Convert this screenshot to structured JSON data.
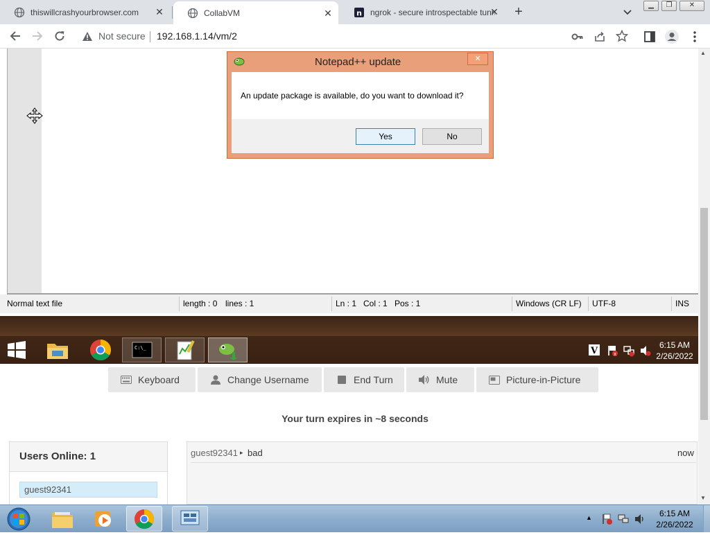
{
  "browser": {
    "tabs": [
      {
        "title": "thiswillcrashyourbrowser.com",
        "active": false
      },
      {
        "title": "CollabVM",
        "active": true
      },
      {
        "title": "ngrok - secure introspectable tunnels",
        "active": false
      }
    ],
    "security_label": "Not secure",
    "url": "192.168.1.14/vm/2"
  },
  "notepadpp": {
    "status": {
      "file_type": "Normal text file",
      "length": "length : 0",
      "lines": "lines : 1",
      "ln": "Ln : 1",
      "col": "Col : 1",
      "pos": "Pos : 1",
      "eol": "Windows (CR LF)",
      "encoding": "UTF-8",
      "mode": "INS"
    }
  },
  "dialog": {
    "title": "Notepad++ update",
    "message": "An update package is available, do you want to download it?",
    "yes_label": "Yes",
    "no_label": "No",
    "close_glyph": "✕"
  },
  "vm_taskbar": {
    "time": "6:15 AM",
    "date": "2/26/2022"
  },
  "collabvm": {
    "buttons": [
      {
        "label": "Keyboard",
        "icon": "keyboard-icon"
      },
      {
        "label": "Change Username",
        "icon": "user-icon"
      },
      {
        "label": "End Turn",
        "icon": "stop-icon"
      },
      {
        "label": "Mute",
        "icon": "speaker-icon"
      },
      {
        "label": "Picture-in-Picture",
        "icon": "pip-icon"
      }
    ],
    "turn_text": "Your turn expires in ~8 seconds",
    "users_online": "Users Online: 1",
    "users": [
      "guest92341"
    ],
    "chat": [
      {
        "user": "guest92341",
        "message": "bad",
        "time": "now"
      }
    ]
  },
  "host_taskbar": {
    "time": "6:15 AM",
    "date": "2/26/2022"
  }
}
